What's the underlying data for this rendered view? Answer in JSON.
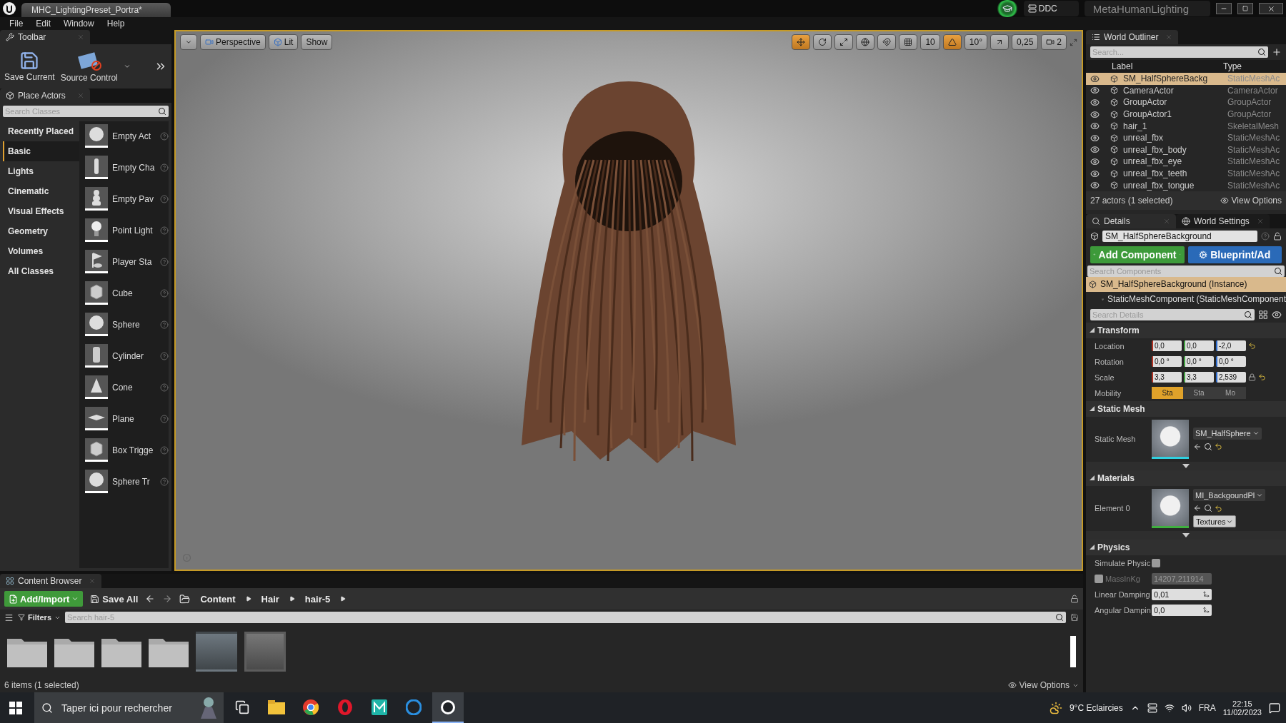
{
  "title_bar": {
    "tab_title": "MHC_LightingPreset_Portra*",
    "ddc": "DDC",
    "project": "MetaHumanLighting"
  },
  "menu": [
    "File",
    "Edit",
    "Window",
    "Help"
  ],
  "toolbar": {
    "tab": "Toolbar",
    "buttons": [
      {
        "kind": "save",
        "label": "Save Current"
      },
      {
        "kind": "source",
        "label": "Source Control"
      }
    ]
  },
  "place_actors": {
    "tab": "Place Actors",
    "search_placeholder": "Search Classes",
    "categories": [
      {
        "label": "Recently Placed",
        "selected": false
      },
      {
        "label": "Basic",
        "selected": true
      },
      {
        "label": "Lights",
        "selected": false
      },
      {
        "label": "Cinematic",
        "selected": false
      },
      {
        "label": "Visual Effects",
        "selected": false
      },
      {
        "label": "Geometry",
        "selected": false
      },
      {
        "label": "Volumes",
        "selected": false
      },
      {
        "label": "All Classes",
        "selected": false
      }
    ],
    "items": [
      {
        "label": "Empty Act",
        "kind": "sphere"
      },
      {
        "label": "Empty Cha",
        "kind": "figure"
      },
      {
        "label": "Empty Pav",
        "kind": "pawn"
      },
      {
        "label": "Point Light",
        "kind": "bulb"
      },
      {
        "label": "Player Sta",
        "kind": "flag"
      },
      {
        "label": "Cube",
        "kind": "cube"
      },
      {
        "label": "Sphere",
        "kind": "sphere"
      },
      {
        "label": "Cylinder",
        "kind": "cylinder"
      },
      {
        "label": "Cone",
        "kind": "cone"
      },
      {
        "label": "Plane",
        "kind": "plane"
      },
      {
        "label": "Box Trigge",
        "kind": "cube"
      },
      {
        "label": "Sphere Tr",
        "kind": "sphere"
      }
    ]
  },
  "viewport": {
    "buttons": [
      "Perspective",
      "Lit",
      "Show"
    ],
    "transform_tools": [
      {
        "kind": "move",
        "selected": true
      },
      {
        "kind": "rotate",
        "selected": false
      },
      {
        "kind": "scale",
        "selected": false
      }
    ],
    "snaps": [
      {
        "kind": "grid",
        "value": "10",
        "on": false
      },
      {
        "kind": "rotation",
        "value": "10°",
        "on": true
      },
      {
        "kind": "scale",
        "value": "0,25",
        "on": false
      }
    ],
    "camera_speed": "2"
  },
  "world_outliner": {
    "tab": "World Outliner",
    "search_placeholder": "Search...",
    "columns": [
      "Label",
      "Type"
    ],
    "rows": [
      {
        "label": "SM_HalfSphereBackg",
        "type": "StaticMeshAc",
        "selected": true
      },
      {
        "label": "CameraActor",
        "type": "CameraActor",
        "selected": false
      },
      {
        "label": "GroupActor",
        "type": "GroupActor",
        "selected": false
      },
      {
        "label": "GroupActor1",
        "type": "GroupActor",
        "selected": false
      },
      {
        "label": "hair_1",
        "type": "SkeletalMesh",
        "selected": false
      },
      {
        "label": "unreal_fbx",
        "type": "StaticMeshAc",
        "selected": false
      },
      {
        "label": "unreal_fbx_body",
        "type": "StaticMeshAc",
        "selected": false
      },
      {
        "label": "unreal_fbx_eye",
        "type": "StaticMeshAc",
        "selected": false
      },
      {
        "label": "unreal_fbx_teeth",
        "type": "StaticMeshAc",
        "selected": false
      },
      {
        "label": "unreal_fbx_tongue",
        "type": "StaticMeshAc",
        "selected": false
      }
    ],
    "status": "27 actors (1 selected)",
    "view_options": "View Options"
  },
  "details": {
    "tabs": [
      {
        "label": "Details",
        "selected": true
      },
      {
        "label": "World Settings",
        "selected": false
      }
    ],
    "actor_name": "SM_HalfSphereBackground",
    "add_component": "Add Component",
    "blueprint": "Blueprint/Ad",
    "search_components_placeholder": "Search Components",
    "components": [
      {
        "label": "SM_HalfSphereBackground (Instance)",
        "selected": true
      },
      {
        "label": "StaticMeshComponent (StaticMeshComponent",
        "selected": false
      }
    ],
    "search_details_placeholder": "Search Details",
    "sections": [
      {
        "title": "Transform",
        "expanded": true,
        "advanced": false,
        "properties": [
          {
            "kind": "vector",
            "label": "Location",
            "values": [
              "0,0",
              "0,0",
              "-2,0"
            ],
            "modified": true,
            "lock": false
          },
          {
            "kind": "vector",
            "label": "Rotation",
            "values": [
              "0,0 °",
              "0,0 °",
              "0,0 °"
            ],
            "modified": false,
            "lock": false
          },
          {
            "kind": "vector",
            "label": "Scale",
            "values": [
              "3,3",
              "3,3",
              "2,539"
            ],
            "modified": true,
            "lock": true
          },
          {
            "kind": "mobility",
            "label": "Mobility",
            "options": [
              {
                "label": "Sta",
                "selected": true
              },
              {
                "label": "Sta",
                "selected": false
              },
              {
                "label": "Mo",
                "selected": false
              }
            ]
          }
        ]
      },
      {
        "title": "Static Mesh",
        "expanded": true,
        "advanced": true,
        "properties": [
          {
            "kind": "asset",
            "color": "#30d0e0",
            "label": "Static Mesh",
            "value": "SM_HalfSphere"
          }
        ]
      },
      {
        "title": "Materials",
        "expanded": true,
        "advanced": true,
        "properties": [
          {
            "kind": "asset",
            "color": "#40b040",
            "label": "Element 0",
            "value": "MI_BackgoundPl",
            "extra": "Textures"
          }
        ]
      },
      {
        "title": "Physics",
        "expanded": true,
        "advanced": false,
        "properties": [
          {
            "kind": "checkbox",
            "label": "Simulate Physic",
            "checked": false
          },
          {
            "kind": "checked_number",
            "label": "MassInKg",
            "checked": false,
            "value": "14207,211914"
          },
          {
            "kind": "number",
            "label": "Linear Damping",
            "value": "0,01"
          },
          {
            "kind": "number",
            "label": "Angular Dampin",
            "value": "0,0"
          }
        ]
      }
    ]
  },
  "content_browser": {
    "tab": "Content Browser",
    "add_import": "Add/Import",
    "save_all": "Save All",
    "path": [
      "Content",
      "Hair",
      "hair-5"
    ],
    "filters": "Filters",
    "search_placeholder": "Search hair-5",
    "assets": [
      {
        "kind": "folder",
        "selected": false
      },
      {
        "kind": "folder",
        "selected": false
      },
      {
        "kind": "folder",
        "selected": false
      },
      {
        "kind": "folder",
        "selected": false
      },
      {
        "kind": "thumbnail",
        "selected": false
      },
      {
        "kind": "thumbnail",
        "selected": true
      }
    ],
    "status": "6 items (1 selected)",
    "view_options": "View Options"
  },
  "taskbar": {
    "search_placeholder": "Taper ici pour rechercher",
    "apps": [
      {
        "kind": "taskview",
        "active": false
      },
      {
        "kind": "files",
        "active": false
      },
      {
        "kind": "chrome",
        "active": false
      },
      {
        "kind": "opera",
        "active": false
      },
      {
        "kind": "teal",
        "active": false
      },
      {
        "kind": "blue",
        "active": false
      },
      {
        "kind": "engine",
        "active": true
      }
    ],
    "weather": "9°C Eclaircies",
    "language": "FRA",
    "time": "22:15",
    "date": "11/02/2023"
  }
}
